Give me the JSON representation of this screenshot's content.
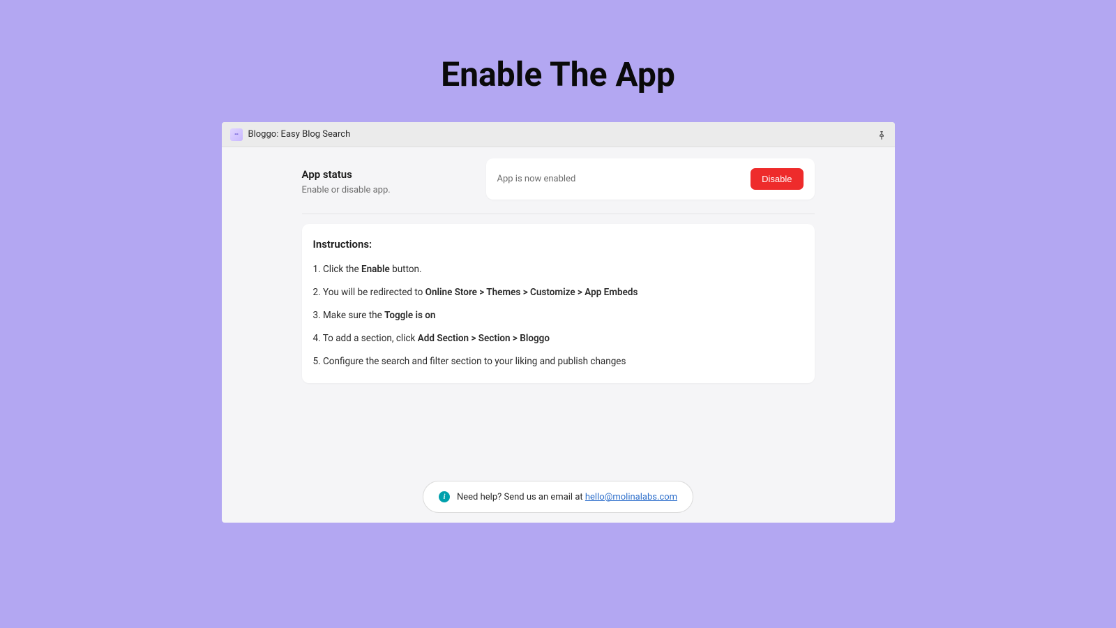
{
  "page": {
    "title": "Enable The App"
  },
  "topbar": {
    "app_name": "Bloggo: Easy Blog Search"
  },
  "status": {
    "section_title": "App status",
    "section_subtitle": "Enable or disable app.",
    "message": "App is now enabled",
    "button_label": "Disable"
  },
  "instructions": {
    "title": "Instructions:",
    "items": [
      {
        "num": "1.",
        "pre": "Click the ",
        "bold": "Enable",
        "post": " button."
      },
      {
        "num": "2.",
        "pre": "You will be redirected to ",
        "bold": "Online Store > Themes > Customize > App Embeds",
        "post": ""
      },
      {
        "num": "3.",
        "pre": "Make sure the ",
        "bold": "Toggle is on",
        "post": ""
      },
      {
        "num": "4.",
        "pre": "To add a section, click ",
        "bold": "Add Section > Section > Bloggo",
        "post": ""
      },
      {
        "num": "5.",
        "pre": "Configure the search and filter section to your liking and publish changes",
        "bold": "",
        "post": ""
      }
    ]
  },
  "help": {
    "text": "Need help? Send us an email at ",
    "email": "hello@molinalabs.com"
  }
}
